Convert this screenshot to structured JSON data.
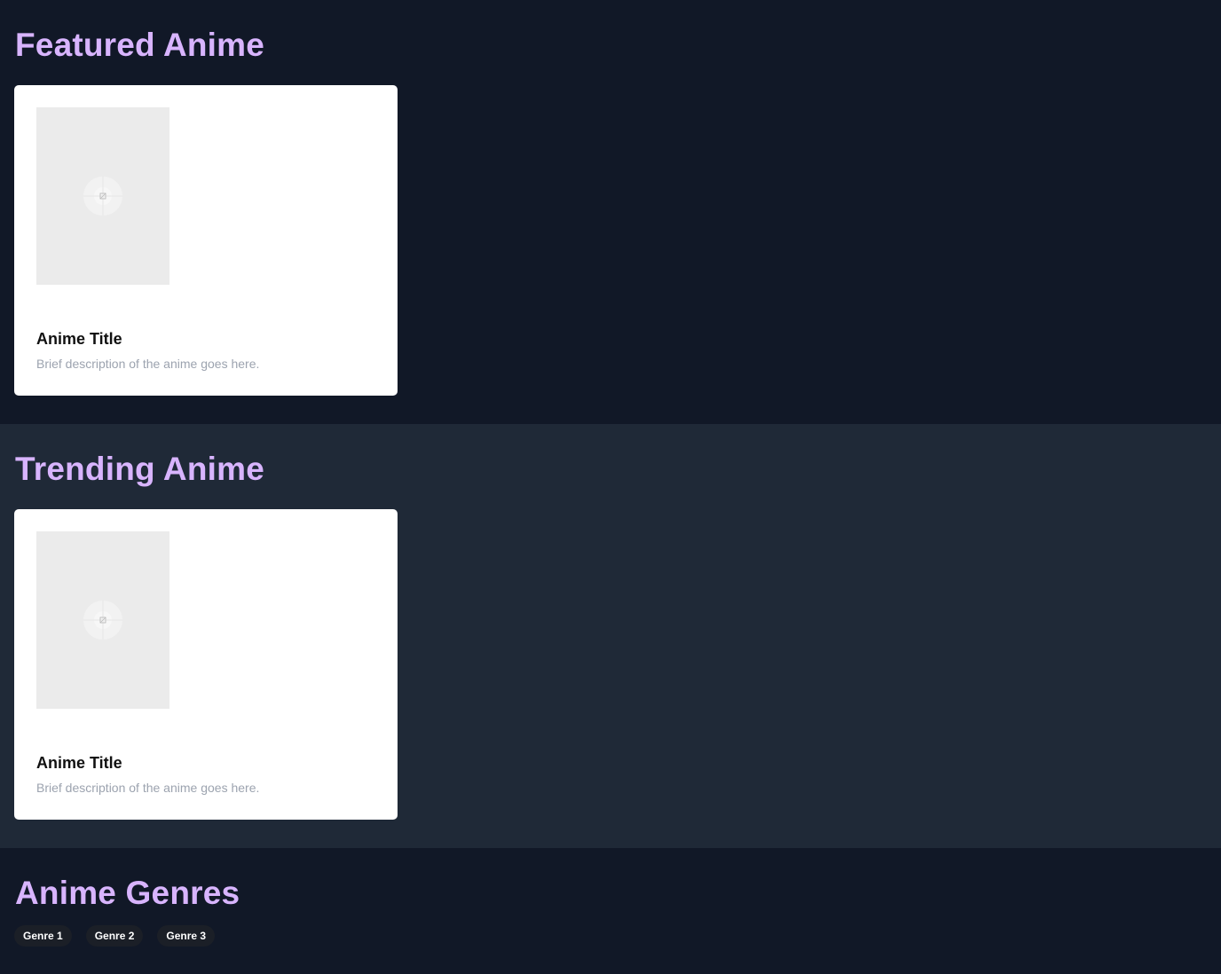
{
  "featured": {
    "title": "Featured Anime",
    "card": {
      "title": "Anime Title",
      "description": "Brief description of the anime goes here."
    }
  },
  "trending": {
    "title": "Trending Anime",
    "card": {
      "title": "Anime Title",
      "description": "Brief description of the anime goes here."
    }
  },
  "genres": {
    "title": "Anime Genres",
    "items": [
      "Genre 1",
      "Genre 2",
      "Genre 3"
    ]
  },
  "colors": {
    "heading": "#d8b4fe",
    "background_dark": "#111827",
    "background_alt": "#1f2937",
    "card": "#ffffff",
    "description": "#9ca3af"
  },
  "icons": {
    "poster_placeholder": "image-placeholder-icon"
  }
}
